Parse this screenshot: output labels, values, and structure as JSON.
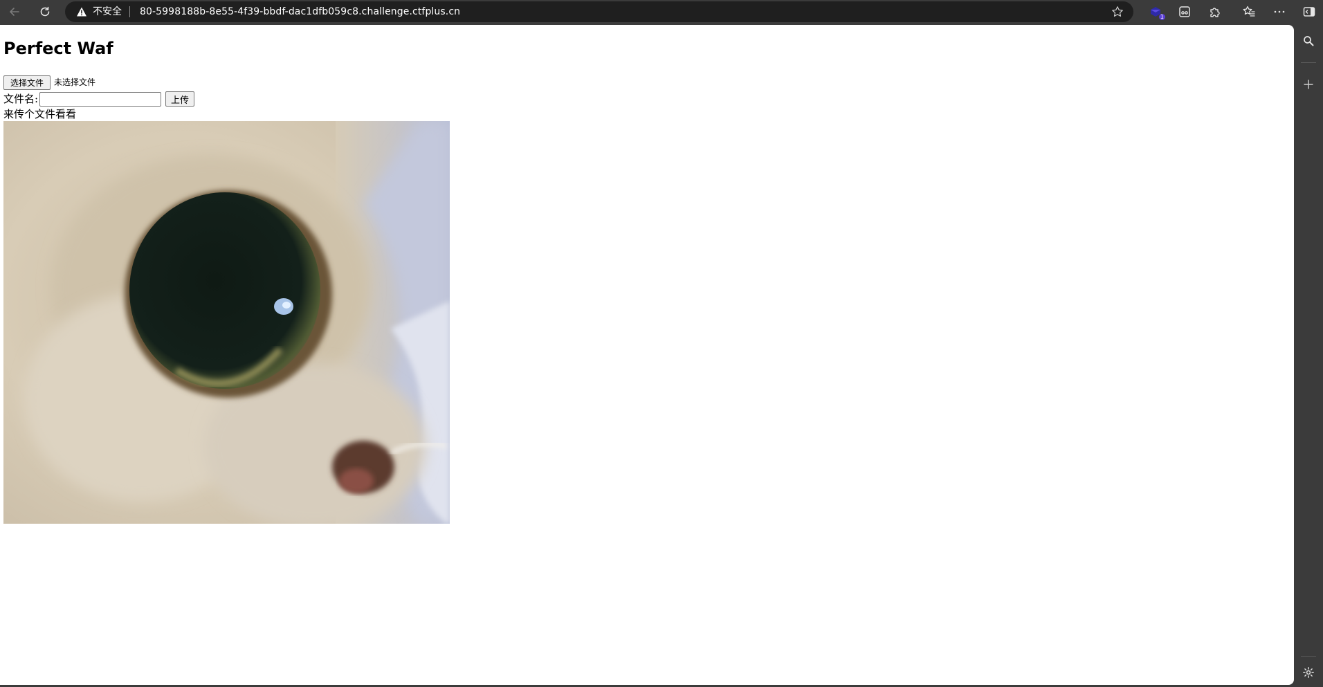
{
  "browser": {
    "security_label": "不安全",
    "url": "80-5998188b-8e55-4f39-bbdf-dac1dfb059c8.challenge.ctfplus.cn",
    "extension_badge_count": "1",
    "icons": {
      "back": "back-arrow-icon",
      "reload": "reload-icon",
      "warning": "warning-triangle-icon",
      "favorite": "star-icon",
      "extension": "extension-icon",
      "reader": "reader-icon",
      "extensions_puzzle": "puzzle-icon",
      "favorites": "favorites-icon",
      "more": "more-dots-icon",
      "sidebar_toggle": "sidebar-toggle-icon"
    }
  },
  "sidebar": {
    "icons": [
      "search-icon",
      "add-icon",
      "settings-icon"
    ]
  },
  "page": {
    "title": "Perfect Waf",
    "file_button_label": "选择文件",
    "no_file_label": "未选择文件",
    "filename_label": "文件名:",
    "filename_value": "",
    "upload_button_label": "上传",
    "hint_text": "来传个文件看看",
    "image": "cat-closeup-photo"
  },
  "colors": {
    "chrome_bg": "#3b3b3b",
    "address_bg": "#1f1f1f",
    "page_bg": "#ffffff",
    "badge": "#5b3fd6"
  }
}
